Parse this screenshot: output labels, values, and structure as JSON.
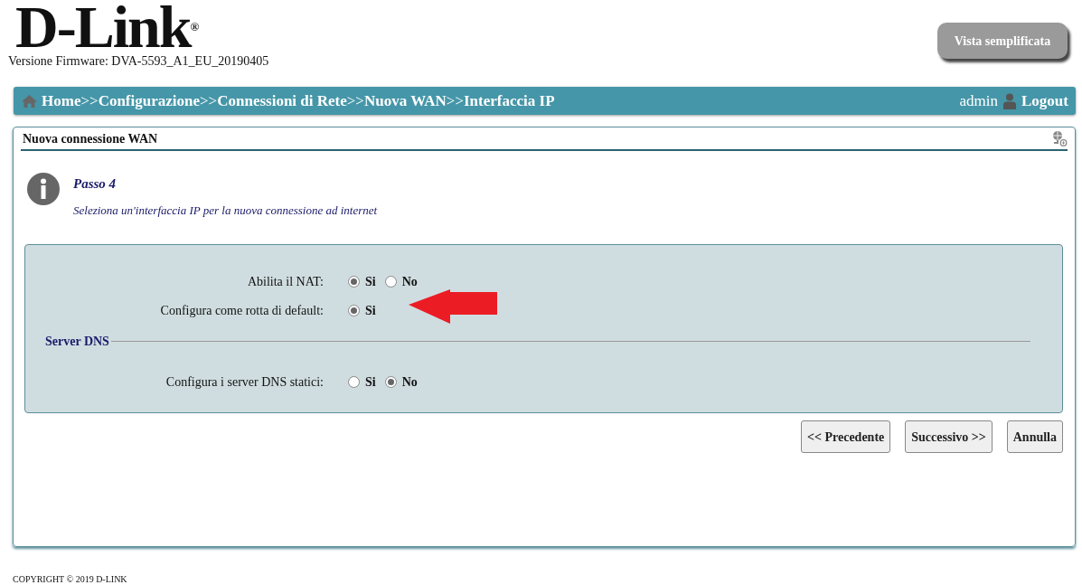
{
  "header": {
    "logo": "D-Link",
    "logo_mark": "®",
    "firmware": "Versione Firmware: DVA-5593_A1_EU_20190405",
    "view_button": "Vista semplificata"
  },
  "breadcrumb": [
    {
      "label": "Home",
      "separator": ">>"
    },
    {
      "label": "Configurazione",
      "separator": ">>"
    },
    {
      "label": "Connessioni di Rete",
      "separator": ">>"
    },
    {
      "label": "Nuova WAN",
      "separator": ">>"
    },
    {
      "label": "Interfaccia IP"
    }
  ],
  "user": {
    "name": "admin",
    "logout": "Logout"
  },
  "panel": {
    "title": "Nuova connessione WAN",
    "step_title": "Passo 4",
    "step_description": "Seleziona un'interfaccia IP per la nuova connessione ad internet",
    "form": [
      {
        "kind": "radio",
        "label": "Abilita il NAT:",
        "options": [
          {
            "label": "Si",
            "selected": true
          },
          {
            "label": "No",
            "selected": false
          }
        ]
      },
      {
        "kind": "radio",
        "label": "Configura come rotta di default:",
        "options": [
          {
            "label": "Si",
            "selected": true
          }
        ]
      },
      {
        "kind": "section",
        "title": "Server DNS"
      },
      {
        "kind": "radio",
        "label": "Configura i server DNS statici:",
        "options": [
          {
            "label": "Si",
            "selected": false
          },
          {
            "label": "No",
            "selected": true
          }
        ]
      }
    ],
    "buttons": [
      "<< Precedente",
      "Successivo >>",
      "Annulla"
    ]
  },
  "footer": "COPYRIGHT © 2019 D-LINK"
}
